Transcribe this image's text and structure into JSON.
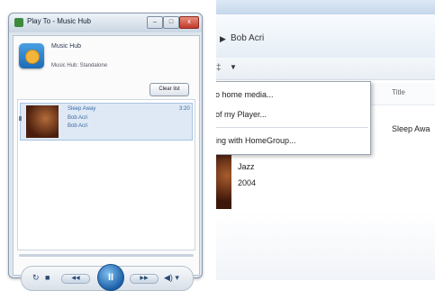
{
  "play_to": {
    "title": "Play To - Music Hub",
    "window_buttons": {
      "minimize": "–",
      "maximize": "□",
      "close": "x"
    },
    "device": {
      "name": "Music Hub",
      "status": "Music Hub: Standalone"
    },
    "clear_label": "Clear list",
    "items": [
      {
        "track": "Sleep Away",
        "artist": "Bob Acri",
        "album": "Bob Acri",
        "duration": "3:20"
      }
    ],
    "controls": {
      "repeat": "↻",
      "stop": "■",
      "prev": "◀◀",
      "play": "II",
      "next": "▶▶",
      "volume": "◀) ▾"
    }
  },
  "media_player": {
    "breadcrumb": {
      "arrow": "▶",
      "label": "Bob Acri"
    },
    "toolbar": {
      "sep": "‡",
      "arrow": "▼"
    },
    "menu": [
      "o home media...",
      "of my Player...",
      "ing with HomeGroup..."
    ],
    "column_title": "Title",
    "song_title": "Sleep Awa",
    "album": {
      "genre": "Jazz",
      "year": "2004"
    }
  }
}
